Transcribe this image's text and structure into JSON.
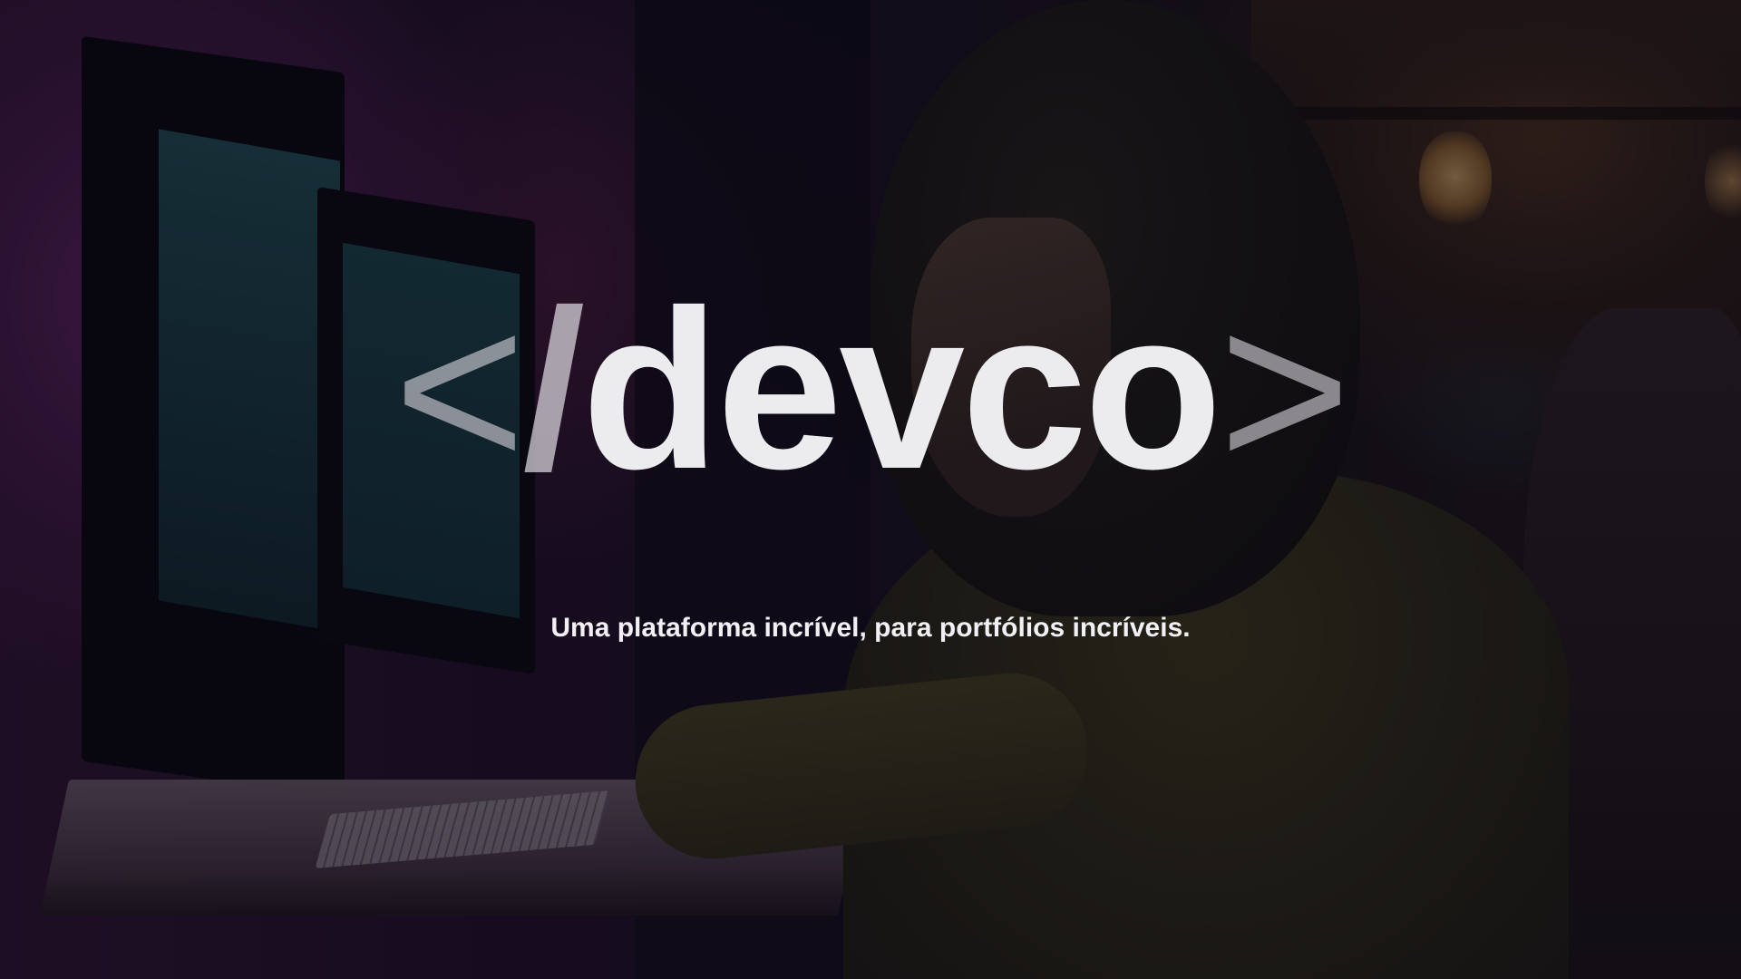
{
  "hero": {
    "logo": {
      "open_bracket": "<",
      "slash": "/",
      "name": "devco",
      "close_bracket": ">"
    },
    "tagline": "Uma plataforma incrível, para portfólios incríveis."
  },
  "colors": {
    "logo_text": "#ececee",
    "logo_brackets": "#d7d4da",
    "tagline_text": "#f2f0f4",
    "overlay": "#08060e"
  }
}
